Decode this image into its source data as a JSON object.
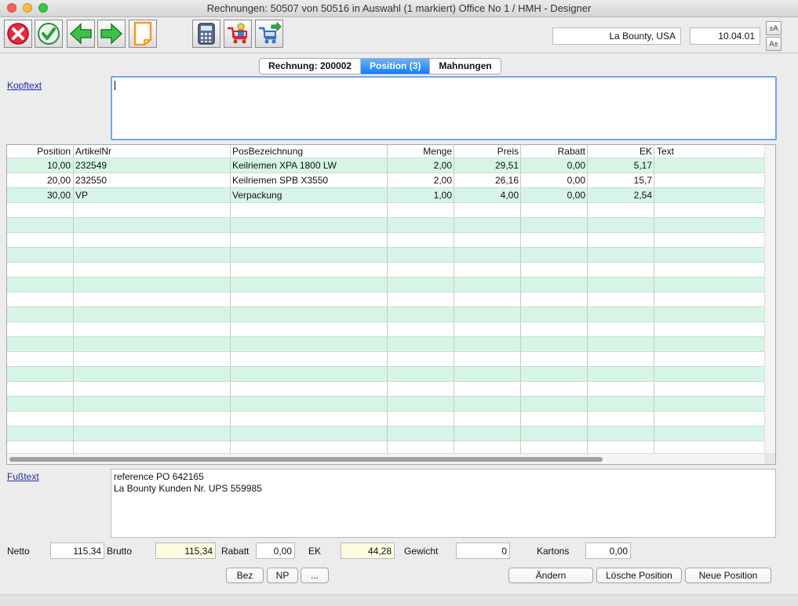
{
  "window": {
    "title": "Rechnungen: 50507 von 50516 in Auswahl  (1 markiert) Office No 1 /  HMH - Designer"
  },
  "toolbar": {
    "buttons": [
      {
        "name": "cancel-button",
        "icon": "red-x-icon"
      },
      {
        "name": "confirm-button",
        "icon": "green-check-icon"
      },
      {
        "name": "previous-button",
        "icon": "green-arrow-left-icon"
      },
      {
        "name": "next-button",
        "icon": "green-arrow-right-icon"
      },
      {
        "name": "new-document-button",
        "icon": "blank-page-icon"
      },
      {
        "name": "calculator-button",
        "icon": "calculator-icon"
      },
      {
        "name": "cart-button",
        "icon": "cart-icon"
      },
      {
        "name": "cart-forward-button",
        "icon": "cart-arrow-icon"
      }
    ],
    "customer": "La Bounty, USA",
    "date": "10.04.01",
    "font_up": "±A",
    "font_down": "A±"
  },
  "tabs": [
    {
      "label": "Rechnung:  200002",
      "active": false
    },
    {
      "label": "Position (3)",
      "active": true
    },
    {
      "label": "Mahnungen",
      "active": false
    }
  ],
  "kopftext": {
    "label": "Kopftext",
    "value": ""
  },
  "table": {
    "columns": [
      "Position",
      "ArtikelNr",
      "PosBezeichnung",
      "Menge",
      "Preis",
      "Rabatt",
      "EK",
      "Text"
    ],
    "rows": [
      [
        "10,00",
        "232549",
        "Keilriemen XPA 1800 LW",
        "2,00",
        "29,51",
        "0,00",
        "5,17",
        ""
      ],
      [
        "20,00",
        "232550",
        "Keilriemen SPB X3550",
        "2,00",
        "26,16",
        "0,00",
        "15,7",
        ""
      ],
      [
        "30,00",
        "VP",
        "Verpackung",
        "1,00",
        "4,00",
        "0,00",
        "2,54",
        ""
      ]
    ]
  },
  "fusstext": {
    "label": "Fußtext",
    "line1": "reference PO 642165",
    "line2": "La Bounty Kunden Nr. UPS 559985"
  },
  "footer": {
    "netto_label": "Netto",
    "netto": "115,34",
    "brutto_label": "Brutto",
    "brutto": "115,34",
    "rabatt_label": "Rabatt",
    "rabatt": "0,00",
    "ek_label": "EK",
    "ek": "44,28",
    "gewicht_label": "Gewicht",
    "gewicht": "0",
    "kartons_label": "Kartons",
    "kartons": "0,00"
  },
  "buttons": {
    "bez": "Bez",
    "np": "NP",
    "more": "...",
    "aendern": "Ändern",
    "loesche": "Lösche Position",
    "neue": "Neue Position"
  }
}
